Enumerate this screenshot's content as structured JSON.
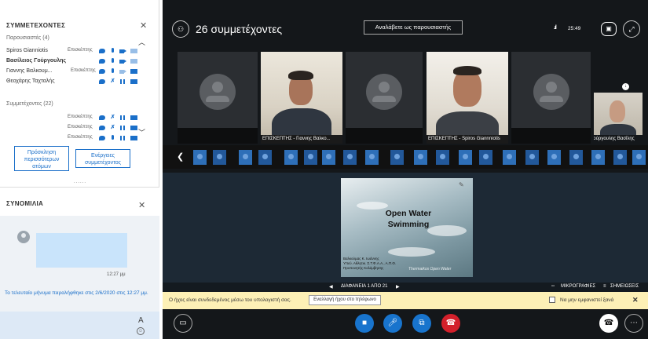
{
  "participants_panel": {
    "title": "ΣΥΜΜΕΤΕΧΟΝΤΕΣ",
    "presenters_header": "Παρουσιαστές (4)",
    "presenters": [
      {
        "name": "Spiros Gianniotis",
        "role": "Επισκέπτης",
        "bold": false
      },
      {
        "name": "Βασίλειος Γούργουλης",
        "role": "",
        "bold": true
      },
      {
        "name": "Γιαννης Βαλκουμ...",
        "role": "Επισκέπτης",
        "bold": false
      },
      {
        "name": "Θεοχάρης Ταχταλής",
        "role": "",
        "bold": false
      }
    ],
    "attendees_header": "Συμμετέχοντες (22)",
    "attendees": [
      {
        "role": "Επισκέπτης"
      },
      {
        "role": "Επισκέπτης"
      },
      {
        "role": "Επισκέπτης"
      }
    ],
    "invite_button": "Πρόσκληση περισσότερων ατόμων",
    "actions_button": "Ενέργειες συμμετέχοντος"
  },
  "chat_panel": {
    "title": "ΣΥΝΟΜΙΛΙΑ",
    "message_time": "12:27 μμ",
    "last_message_note": "Το τελευταίο μήνυμα παραλήφθηκε στις 2/6/2020 στις 12:27 μμ.",
    "format_label": "A",
    "emoji_label": "☺"
  },
  "meeting": {
    "participant_count": "26 συμμετέχοντες",
    "present_button": "Αναλάβετε ως παρουσιαστής",
    "timer": "25:49",
    "signal": ".ıl",
    "tiles": [
      {
        "caption": ""
      },
      {
        "caption": "ΕΠΙΣΚΕΠΤΗΣ - Γιαννης Βαλκο..."
      },
      {
        "caption": ""
      },
      {
        "caption": "ΕΠΙΣΚΕΠΤΗΣ - Spiros Giannniotis"
      },
      {
        "caption": ""
      },
      {
        "caption": "Γούργουλης Βασίλης"
      }
    ],
    "slide": {
      "title": "Open Water Swimming",
      "credits": "Βαλκούμας Κ. Ιωάννης\nΥπεύ. Αθλητικ. Σ.Τ.Φ.Α.Α., Α.Π.Θ.\nΠροπονητής Κολύμβησης",
      "watermark": "Thermaikos Open Water"
    },
    "slide_nav": "ΔΙΑΦΑΝΕΙΑ 1 ΑΠΟ 21",
    "thumbnails_label": "ΜΙΚΡΟΓΡΑΦΙΕΣ",
    "notes_label": "ΣΗΜΕΙΩΣΕΙΣ",
    "audio_notice": "Ο ήχος είναι συνδεδεμένος μέσω του υπολογιστή σας.",
    "switch_audio_button": "Εναλλαγή ήχου στο τηλέφωνο",
    "dont_show_label": "Να μην εμφανιστεί ξανά"
  }
}
